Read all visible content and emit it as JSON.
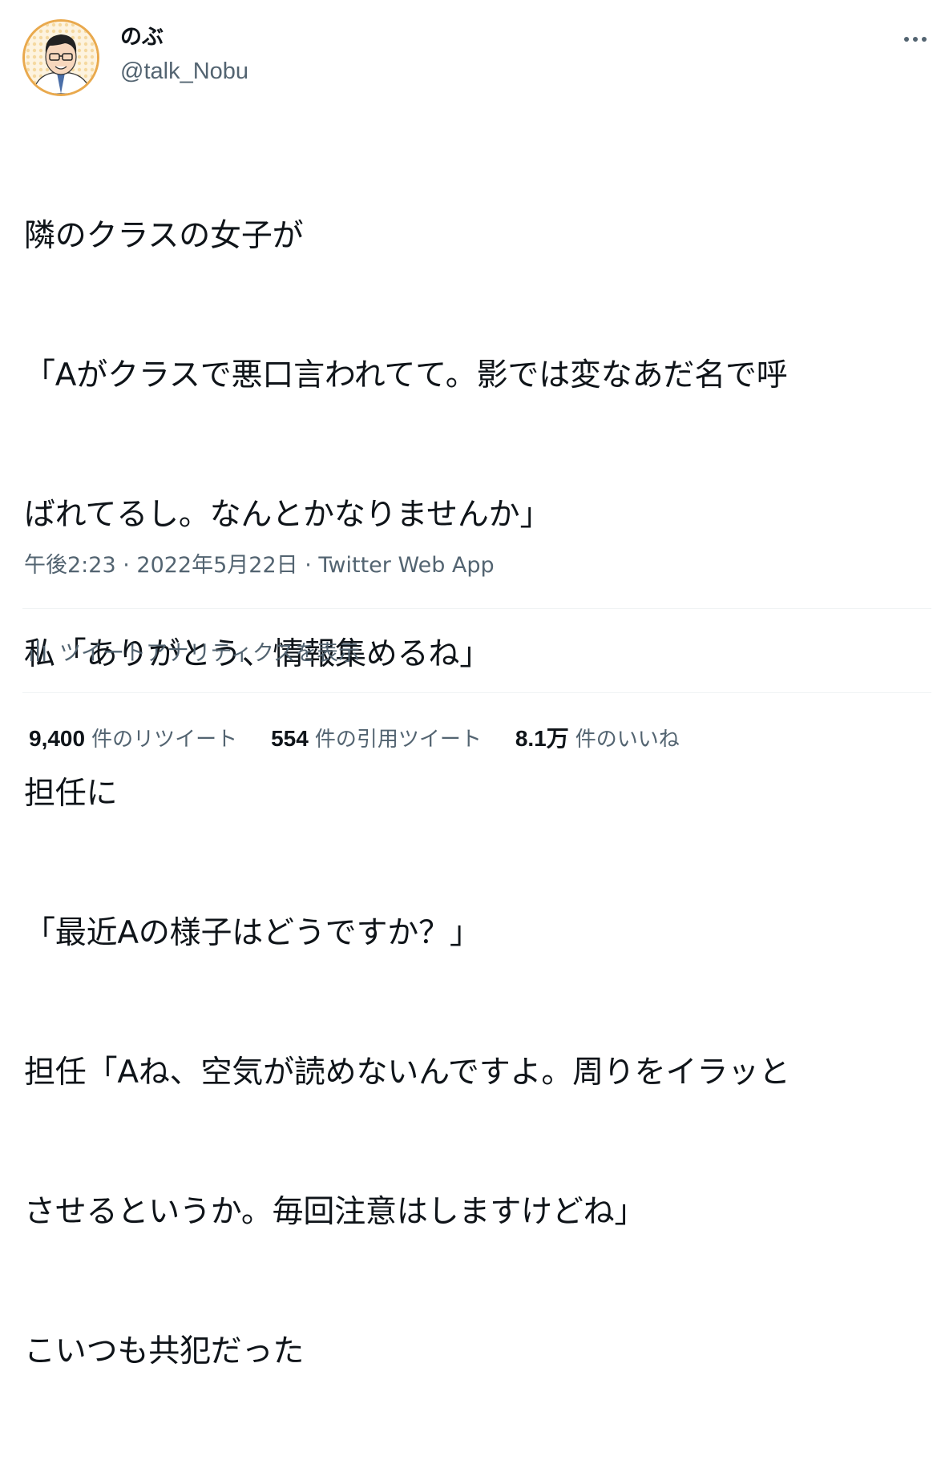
{
  "user": {
    "display_name": "のぶ",
    "handle": "@talk_Nobu",
    "avatar_icon": "profile-avatar"
  },
  "menu_icon": "more-horizontal-icon",
  "tweet": {
    "lines": [
      "隣のクラスの女子が",
      "「Aがクラスで悪口言われてて。影では変なあだ名で呼",
      "ばれてるし。なんとかなりませんか」",
      "私「ありがとう、情報集めるね」",
      "担任に",
      "「最近Aの様子はどうですか？」",
      "担任「Aね、空気が読めないんですよ。周りをイラッと",
      "させるというか。毎回注意はしますけどね」",
      "こいつも共犯だった"
    ]
  },
  "meta": {
    "time": "午後2:23",
    "date": "2022年5月22日",
    "separator": " · ",
    "app": "Twitter Web App"
  },
  "analytics": {
    "icon": "analytics-bar-icon",
    "label": "ツイートアナリティクスを表示"
  },
  "stats": [
    {
      "value": "9,400",
      "label": "件のリツイート"
    },
    {
      "value": "554",
      "label": "件の引用ツイート"
    },
    {
      "value": "8.1万",
      "label": "件のいいね"
    }
  ],
  "colors": {
    "text": "#0f1419",
    "secondary": "#536471",
    "divider": "#eff3f4",
    "avatar_border": "#e9a94d"
  }
}
